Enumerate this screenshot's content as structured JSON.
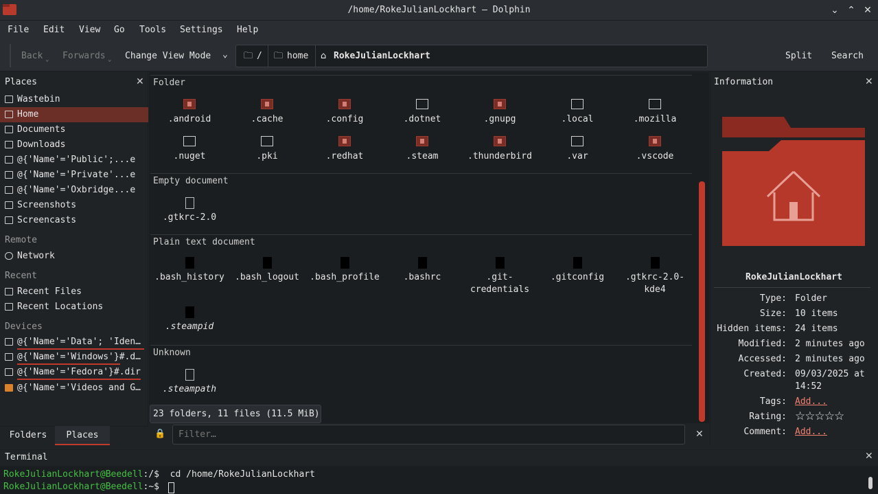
{
  "window": {
    "title": "/home/RokeJulianLockhart — Dolphin"
  },
  "menu": [
    "File",
    "Edit",
    "View",
    "Go",
    "Tools",
    "Settings",
    "Help"
  ],
  "toolbar": {
    "back": "Back",
    "forwards": "Forwards",
    "view_mode": "Change View Mode",
    "split": "Split",
    "search": "Search"
  },
  "breadcrumb": {
    "root": "/",
    "home": "home",
    "current": "RokeJulianLockhart"
  },
  "places": {
    "title": "Places",
    "items": [
      "Wastebin",
      "Home",
      "Documents",
      "Downloads",
      "@{'Name'='Public';...e",
      "@{'Name'='Private'...e",
      "@{'Name'='Oxbridge...e",
      "Screenshots",
      "Screencasts"
    ],
    "remote_title": "Remote",
    "remote": [
      "Network"
    ],
    "recent_title": "Recent",
    "recent": [
      "Recent Files",
      "Recent Locations"
    ],
    "devices_title": "Devices",
    "devices": [
      "@{'Name'='Data'; 'Iden…",
      "@{'Name'='Windows'}#.d…",
      "@{'Name'='Fedora'}#.dir",
      "@{'Name'='Videos and G…"
    ],
    "tabs": [
      "Folders",
      "Places"
    ]
  },
  "groups": {
    "folder": "Folder",
    "folders": [
      ".android",
      ".cache",
      ".config",
      ".dotnet",
      ".gnupg",
      ".local",
      ".mozilla",
      ".nuget",
      ".pki",
      ".redhat",
      ".steam",
      ".thunderbird",
      ".var",
      ".vscode"
    ],
    "empty": "Empty document",
    "empty_files": [
      ".gtkrc-2.0"
    ],
    "plain": "Plain text document",
    "plain_files": [
      ".bash_history",
      ".bash_logout",
      ".bash_profile",
      ".bashrc",
      ".git-\ncredentials",
      ".gitconfig",
      ".gtkrc-2.0-\nkde4",
      ".steampid"
    ],
    "unknown": "Unknown",
    "unknown_files": [
      ".steampath"
    ]
  },
  "status": "23 folders, 11 files (11.5 MiB)",
  "filter_placeholder": "Filter…",
  "info": {
    "title": "Information",
    "name": "RokeJulianLockhart",
    "type_k": "Type:",
    "type": "Folder",
    "size_k": "Size:",
    "size": "10 items",
    "hidden_k": "Hidden items:",
    "hidden": "24 items",
    "modified_k": "Modified:",
    "modified": "2 minutes ago",
    "accessed_k": "Accessed:",
    "accessed": "2 minutes ago",
    "created_k": "Created:",
    "created1": "09/03/2025 at",
    "created2": "14:52",
    "tags_k": "Tags:",
    "tags": "Add...",
    "rating_k": "Rating:",
    "rating": 0,
    "comment_k": "Comment:",
    "comment": "Add..."
  },
  "terminal": {
    "title": "Terminal",
    "prompt": "RokeJulianLockhart@Beedell",
    "line1_path": ":/$",
    "line1_cmd": "  cd /home/RokeJulianLockhart",
    "line2_path": ":~$ "
  },
  "colors": {
    "accent": "#c0392b",
    "selection": "#6b2f28",
    "folder": "#b5382a"
  }
}
